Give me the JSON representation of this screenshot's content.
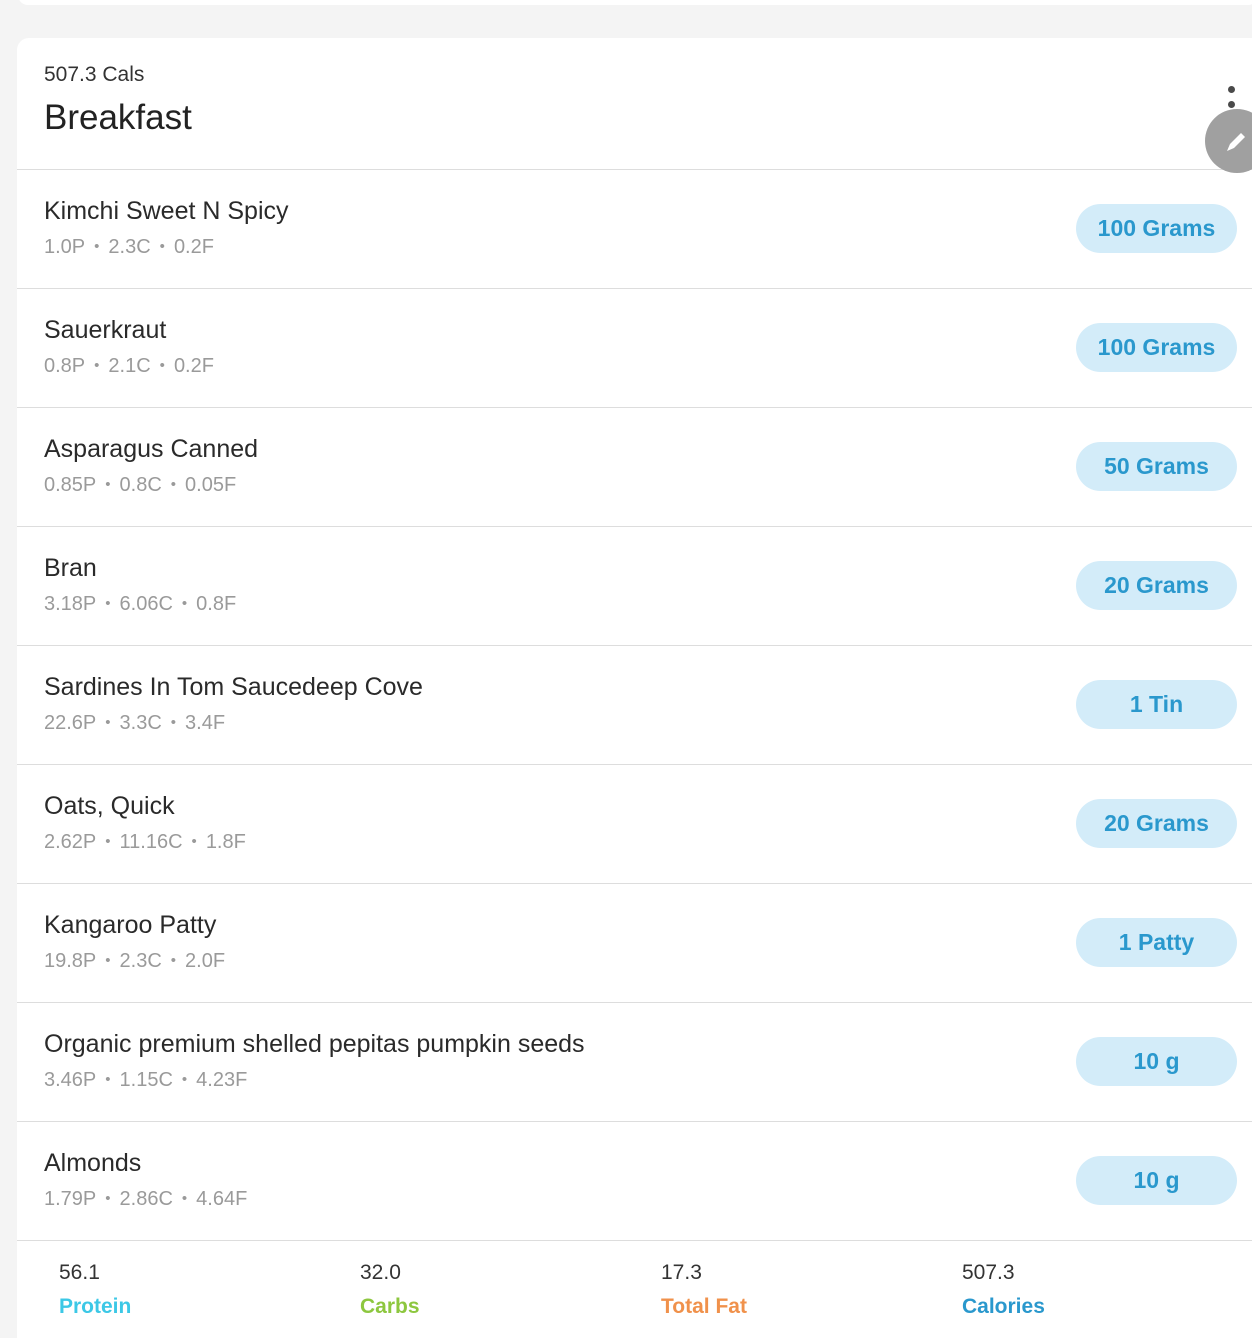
{
  "meal": {
    "calories_label": "507.3 Cals",
    "title": "Breakfast"
  },
  "icons": {
    "more": "more-vertical-icon",
    "edit": "pencil-icon"
  },
  "items": [
    {
      "name": "Kimchi Sweet N Spicy",
      "protein": "1.0P",
      "carbs": "2.3C",
      "fat": "0.2F",
      "quantity": "100 Grams"
    },
    {
      "name": "Sauerkraut",
      "protein": "0.8P",
      "carbs": "2.1C",
      "fat": "0.2F",
      "quantity": "100 Grams"
    },
    {
      "name": "Asparagus Canned",
      "protein": "0.85P",
      "carbs": "0.8C",
      "fat": "0.05F",
      "quantity": "50 Grams"
    },
    {
      "name": "Bran",
      "protein": "3.18P",
      "carbs": "6.06C",
      "fat": "0.8F",
      "quantity": "20 Grams"
    },
    {
      "name": "Sardines In Tom Saucedeep Cove",
      "protein": "22.6P",
      "carbs": "3.3C",
      "fat": "3.4F",
      "quantity": "1 Tin"
    },
    {
      "name": "Oats, Quick",
      "protein": "2.62P",
      "carbs": "11.16C",
      "fat": "1.8F",
      "quantity": "20 Grams"
    },
    {
      "name": "Kangaroo Patty",
      "protein": "19.8P",
      "carbs": "2.3C",
      "fat": "2.0F",
      "quantity": "1 Patty"
    },
    {
      "name": "Organic premium shelled pepitas pumpkin seeds",
      "protein": "3.46P",
      "carbs": "1.15C",
      "fat": "4.23F",
      "quantity": "10 g"
    },
    {
      "name": "Almonds",
      "protein": "1.79P",
      "carbs": "2.86C",
      "fat": "4.64F",
      "quantity": "10 g"
    }
  ],
  "separator": "•",
  "totals": [
    {
      "value": "56.1",
      "label": "Protein",
      "color": "#3cc8e6"
    },
    {
      "value": "32.0",
      "label": "Carbs",
      "color": "#8dc73f"
    },
    {
      "value": "17.3",
      "label": "Total Fat",
      "color": "#f0914b"
    },
    {
      "value": "507.3",
      "label": "Calories",
      "color": "#2a98cd"
    }
  ],
  "colors": {
    "quantity_bg": "#d3ecf9",
    "quantity_text": "#2a98cd"
  }
}
